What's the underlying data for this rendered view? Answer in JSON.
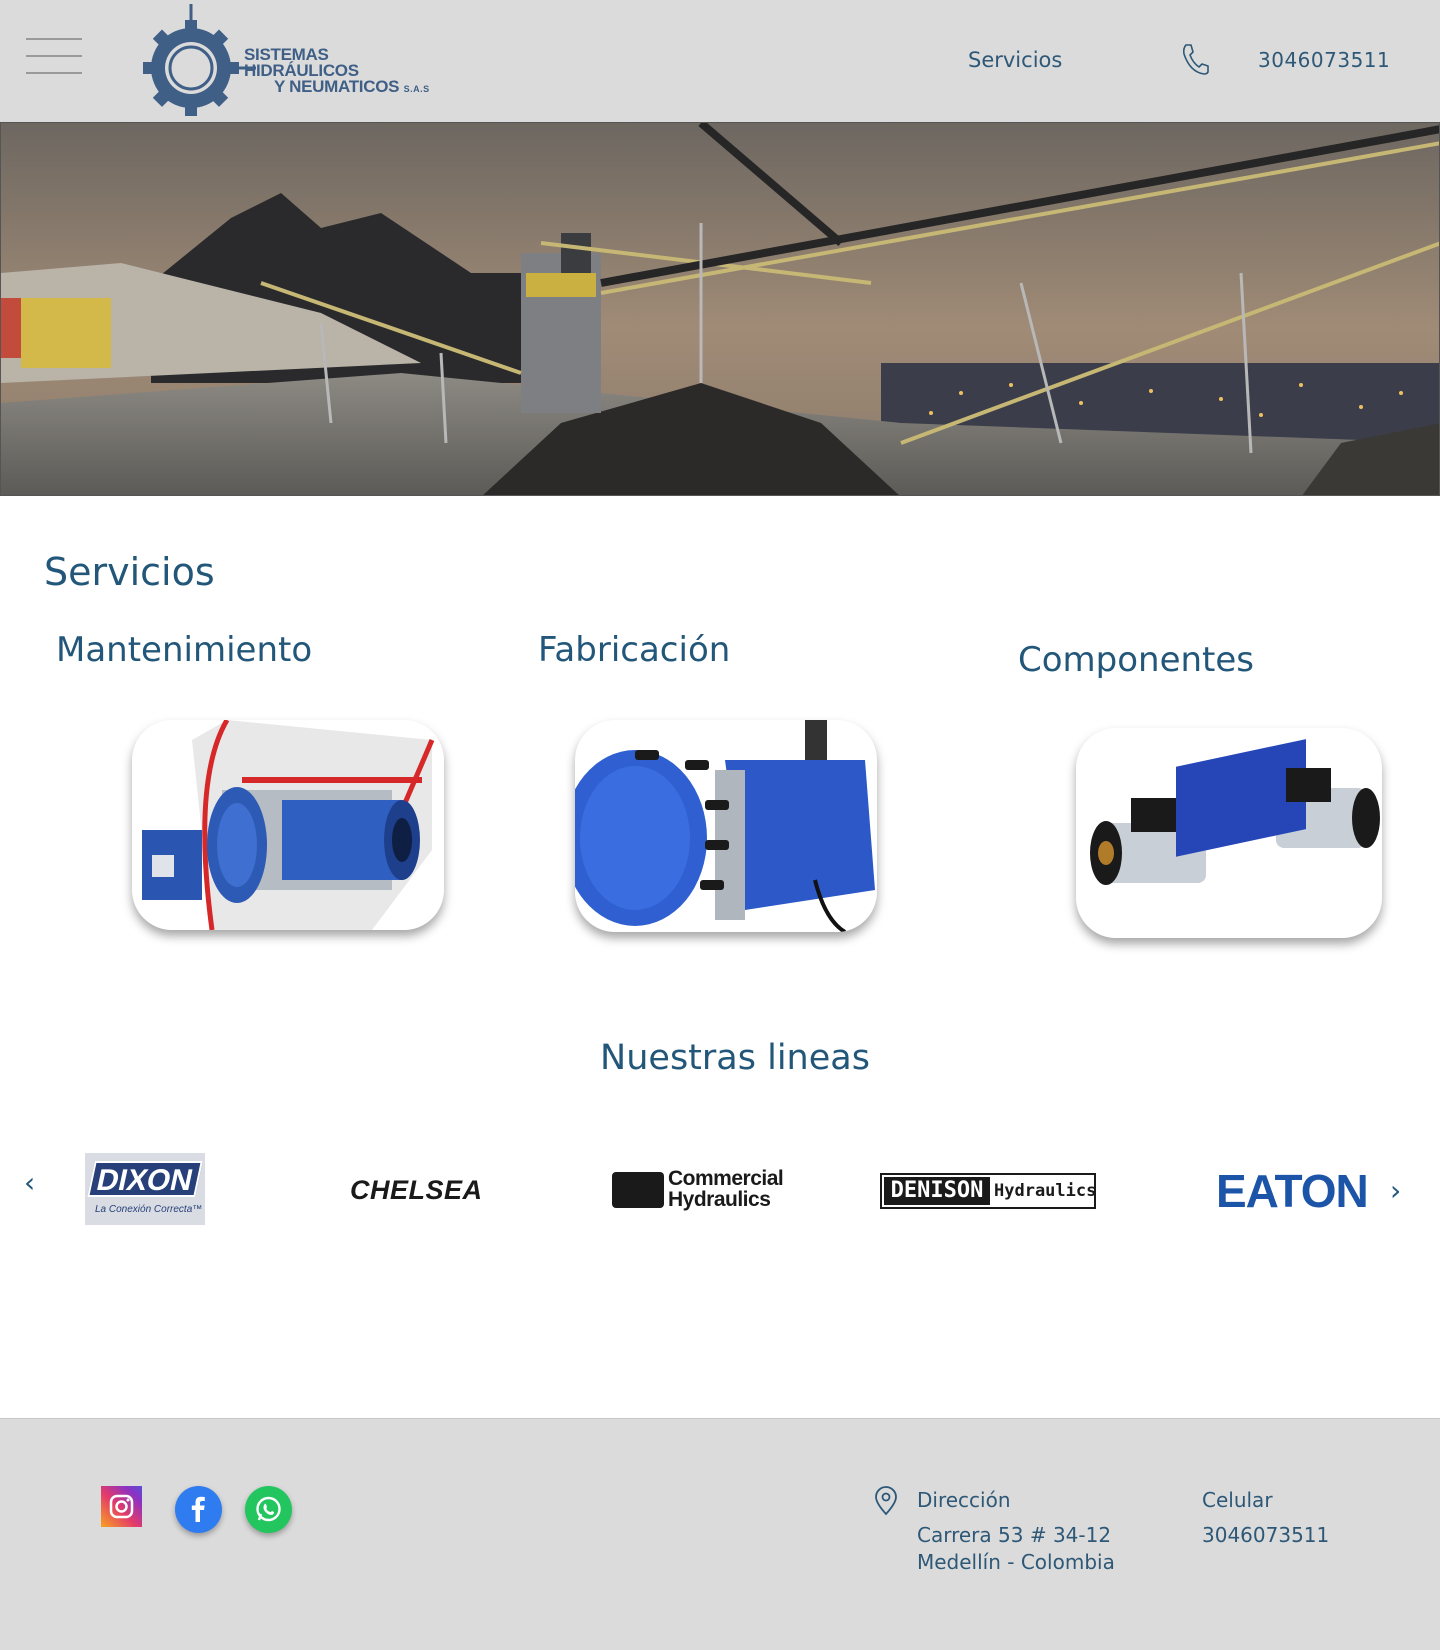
{
  "header": {
    "logo_line1": "SISTEMAS HIDRÁULICOS",
    "logo_line2": "Y NEUMATICOS",
    "logo_suffix": "S.A.S",
    "nav_servicios": "Servicios",
    "phone": "3046073511"
  },
  "services": {
    "title": "Servicios",
    "items": [
      {
        "label": "Mantenimiento"
      },
      {
        "label": "Fabricación"
      },
      {
        "label": "Componentes"
      }
    ]
  },
  "lines": {
    "title": "Nuestras lineas",
    "prev_arrow": "‹",
    "next_arrow": "›",
    "brands": {
      "dixon": "DIXON",
      "dixon_tag": "La Conexión Correcta™",
      "chelsea": "CHELSEA",
      "commercial_1": "Commercial",
      "commercial_2": "Hydraulics",
      "denison_1": "DENISON",
      "denison_2": "Hydraulics",
      "eaton": "EATON"
    }
  },
  "footer": {
    "address_label": "Dirección",
    "address_line1": "Carrera 53 # 34-12",
    "address_line2": "Medellín - Colombia",
    "phone_label": "Celular",
    "phone": "3046073511"
  },
  "colors": {
    "text": "#23577a",
    "header_bg": "#dbdbdb",
    "logo_blue": "#3f5f86",
    "eaton_blue": "#1c55a8"
  },
  "icons": [
    "menu-icon",
    "gear-logo-icon",
    "phone-icon",
    "instagram-icon",
    "facebook-icon",
    "whatsapp-icon",
    "location-pin-icon"
  ]
}
